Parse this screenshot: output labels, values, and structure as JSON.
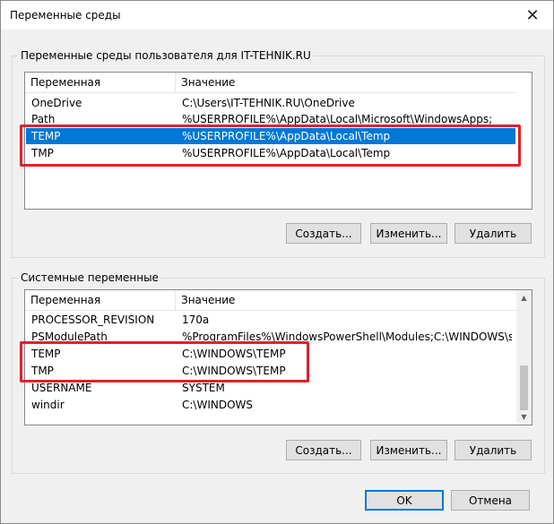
{
  "window": {
    "title": "Переменные среды",
    "close_icon": "close-icon"
  },
  "user_group": {
    "label": "Переменные среды пользователя для IT-TEHNIK.RU",
    "columns": [
      "Переменная",
      "Значение"
    ],
    "rows": [
      {
        "name": "OneDrive",
        "value": "C:\\Users\\IT-TEHNIK.RU\\OneDrive"
      },
      {
        "name": "Path",
        "value": "%USERPROFILE%\\AppData\\Local\\Microsoft\\WindowsApps;"
      },
      {
        "name": "TEMP",
        "value": "%USERPROFILE%\\AppData\\Local\\Temp",
        "selected": true
      },
      {
        "name": "TMP",
        "value": "%USERPROFILE%\\AppData\\Local\\Temp"
      }
    ],
    "buttons": {
      "create": "Создать...",
      "edit": "Изменить...",
      "delete": "Удалить"
    }
  },
  "system_group": {
    "label": "Системные переменные",
    "columns": [
      "Переменная",
      "Значение"
    ],
    "rows": [
      {
        "name": "PROCESSOR_REVISION",
        "value": "170a"
      },
      {
        "name": "PSModulePath",
        "value": "%ProgramFiles%\\WindowsPowerShell\\Modules;C:\\WINDOWS\\syst..."
      },
      {
        "name": "TEMP",
        "value": "C:\\WINDOWS\\TEMP"
      },
      {
        "name": "TMP",
        "value": "C:\\WINDOWS\\TEMP"
      },
      {
        "name": "USERNAME",
        "value": "SYSTEM"
      },
      {
        "name": "windir",
        "value": "C:\\WINDOWS"
      }
    ],
    "buttons": {
      "create": "Создать...",
      "edit": "Изменить...",
      "delete": "Удалить"
    }
  },
  "footer": {
    "ok": "OK",
    "cancel": "Отмена"
  },
  "colors": {
    "selection": "#0078d7",
    "highlight": "#e0202a"
  }
}
